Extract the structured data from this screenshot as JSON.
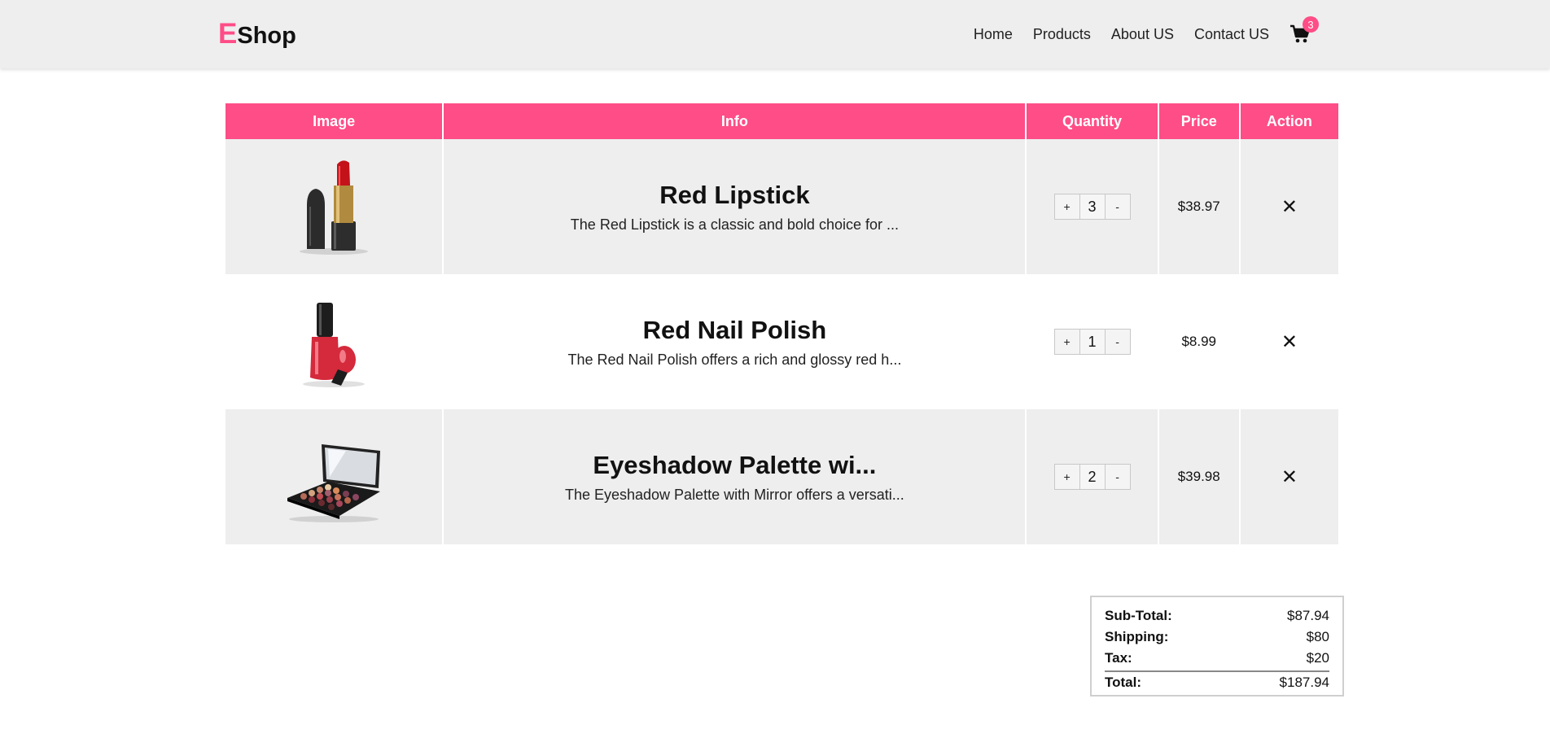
{
  "brand": {
    "first_letter": "E",
    "rest": "Shop",
    "accent": "#ff4d87"
  },
  "nav": {
    "items": [
      "Home",
      "Products",
      "About US",
      "Contact US"
    ],
    "cart_icon": "shopping-cart-icon",
    "cart_count": "3"
  },
  "table": {
    "headers": [
      "Image",
      "Info",
      "Quantity",
      "Price",
      "Action"
    ],
    "rows": [
      {
        "name": "Red Lipstick",
        "desc": "The Red Lipstick is a classic and bold choice for ...",
        "qty": "3",
        "plus": "+",
        "minus": "-",
        "price": "$38.97",
        "remove": "✕",
        "image_icon": "lipstick-image"
      },
      {
        "name": "Red Nail Polish",
        "desc": "The Red Nail Polish offers a rich and glossy red h...",
        "qty": "1",
        "plus": "+",
        "minus": "-",
        "price": "$8.99",
        "remove": "✕",
        "image_icon": "nail-polish-image"
      },
      {
        "name": "Eyeshadow Palette wi...",
        "desc": "The Eyeshadow Palette with Mirror offers a versati...",
        "qty": "2",
        "plus": "+",
        "minus": "-",
        "price": "$39.98",
        "remove": "✕",
        "image_icon": "eyeshadow-palette-image"
      }
    ]
  },
  "totals": {
    "subtotal_label": "Sub-Total:",
    "subtotal": "$87.94",
    "shipping_label": "Shipping:",
    "shipping": "$80",
    "tax_label": "Tax:",
    "tax": "$20",
    "total_label": "Total:",
    "total": "$187.94"
  }
}
